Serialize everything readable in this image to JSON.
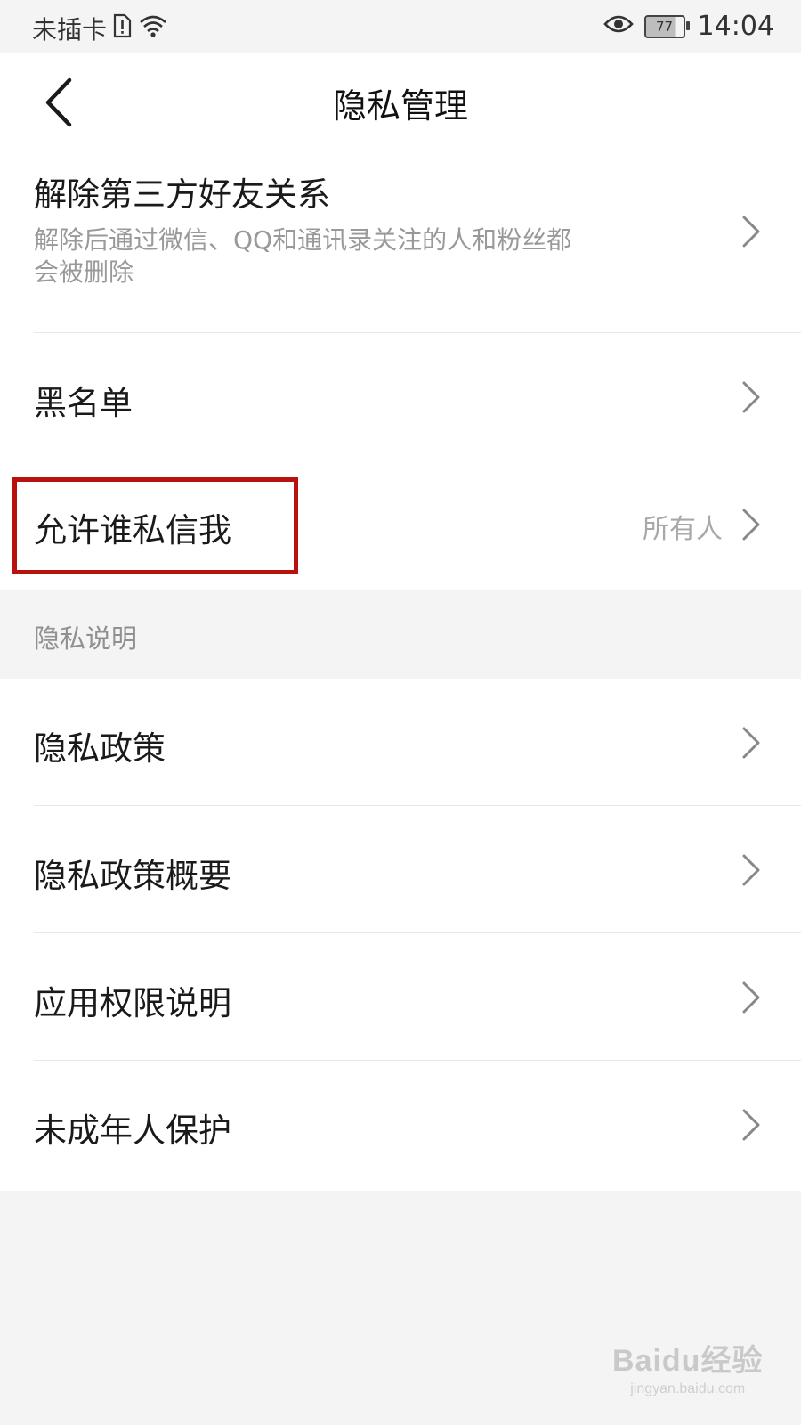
{
  "status_bar": {
    "carrier": "未插卡",
    "battery": "77",
    "time": "14:04",
    "icons": [
      "sim-alert-icon",
      "wifi-icon",
      "eye-icon",
      "battery-icon"
    ]
  },
  "header": {
    "title": "隐私管理",
    "back_icon": "back-arrow-icon"
  },
  "group1": {
    "unbind": {
      "label": "解除第三方好友关系",
      "desc": "解除后通过微信、QQ和通讯录关注的人和粉丝都会被删除"
    },
    "blacklist": {
      "label": "黑名单"
    },
    "messages": {
      "label": "允许谁私信我",
      "value": "所有人"
    }
  },
  "section_title": "隐私说明",
  "group2": [
    {
      "label": "隐私政策"
    },
    {
      "label": "隐私政策概要"
    },
    {
      "label": "应用权限说明"
    },
    {
      "label": "未成年人保护"
    }
  ],
  "watermark": {
    "brand": "Baidu经验",
    "domain": "jingyan.baidu.com"
  },
  "colors": {
    "highlight": "#b8120f",
    "background": "#f4f4f4"
  }
}
